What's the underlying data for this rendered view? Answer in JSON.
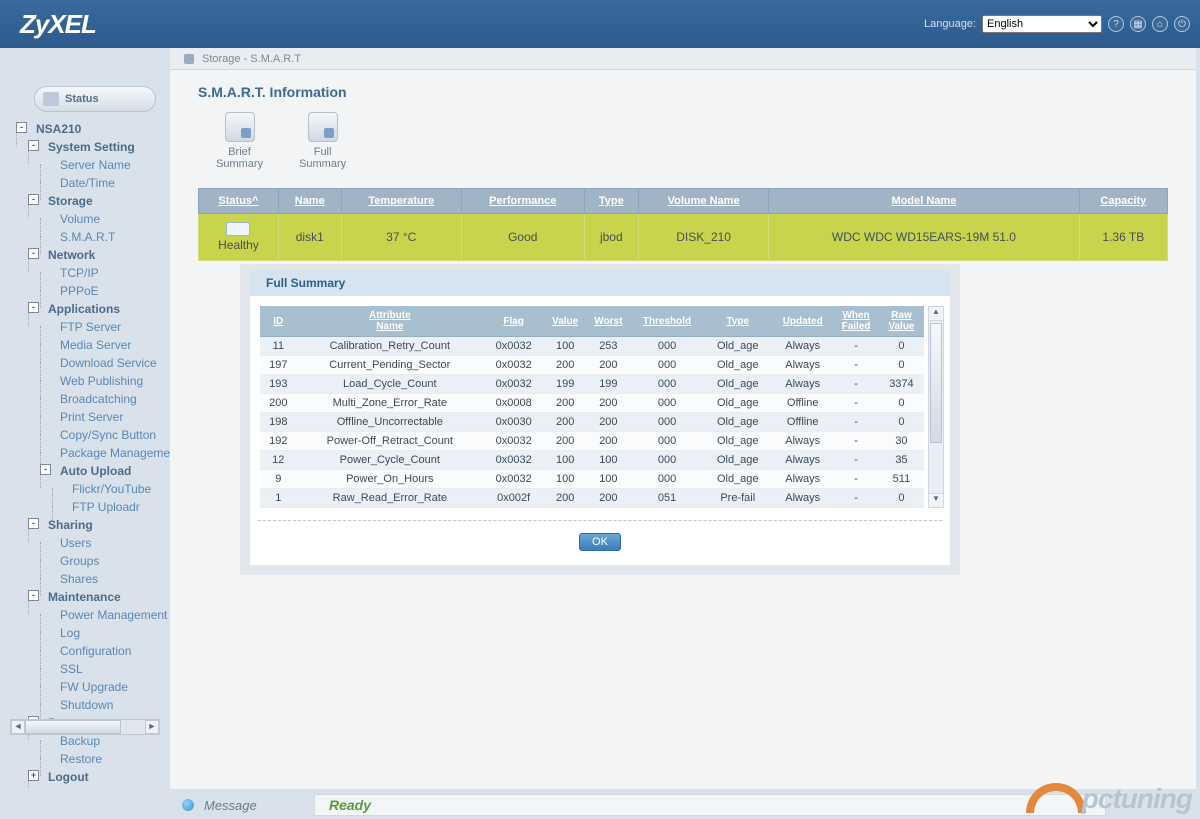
{
  "brand": "ZyXEL",
  "topbar": {
    "language_label": "Language:",
    "language_value": "English"
  },
  "breadcrumb": "Storage - S.M.A.R.T",
  "sidebar": {
    "status": "Status",
    "root": "NSA210",
    "nodes": [
      {
        "label": "System Setting",
        "children": [
          "Server Name",
          "Date/Time"
        ]
      },
      {
        "label": "Storage",
        "children": [
          "Volume",
          "S.M.A.R.T"
        ]
      },
      {
        "label": "Network",
        "children": [
          "TCP/IP",
          "PPPoE"
        ]
      },
      {
        "label": "Applications",
        "children": [
          "FTP Server",
          "Media Server",
          "Download Service",
          "Web Publishing",
          "Broadcatching",
          "Print Server",
          "Copy/Sync Button",
          "Package Manageme"
        ]
      },
      {
        "label": "Auto Upload",
        "children": [
          "Flickr/YouTube",
          "FTP Uploadr"
        ],
        "indent": true
      },
      {
        "label": "Sharing",
        "children": [
          "Users",
          "Groups",
          "Shares"
        ]
      },
      {
        "label": "Maintenance",
        "children": [
          "Power Management",
          "Log",
          "Configuration",
          "SSL",
          "FW Upgrade",
          "Shutdown"
        ]
      },
      {
        "label": "Protect",
        "children": [
          "Backup",
          "Restore"
        ]
      },
      {
        "label": "Logout",
        "children": []
      }
    ]
  },
  "page": {
    "title": "S.M.A.R.T. Information",
    "actions": {
      "brief": "Brief\nSummary",
      "full": "Full\nSummary"
    },
    "disk_table": {
      "headers": [
        "Status",
        "Name",
        "Temperature",
        "Performance",
        "Type",
        "Volume Name",
        "Model Name",
        "Capacity"
      ],
      "row": {
        "status": "Healthy",
        "name": "disk1",
        "temp": "37 °C",
        "perf": "Good",
        "type": "jbod",
        "vol": "DISK_210",
        "model": "WDC WDC WD15EARS-19M 51.0",
        "cap": "1.36 TB"
      }
    }
  },
  "modal": {
    "title": "Full Summary",
    "headers": [
      "ID",
      "Attribute Name",
      "Flag",
      "Value",
      "Worst",
      "Threshold",
      "Type",
      "Updated",
      "When Failed",
      "Raw Value"
    ],
    "rows": [
      {
        "id": "11",
        "attr": "Calibration_Retry_Count",
        "flag": "0x0032",
        "val": "100",
        "worst": "253",
        "thr": "000",
        "type": "Old_age",
        "upd": "Always",
        "fail": "-",
        "raw": "0"
      },
      {
        "id": "197",
        "attr": "Current_Pending_Sector",
        "flag": "0x0032",
        "val": "200",
        "worst": "200",
        "thr": "000",
        "type": "Old_age",
        "upd": "Always",
        "fail": "-",
        "raw": "0"
      },
      {
        "id": "193",
        "attr": "Load_Cycle_Count",
        "flag": "0x0032",
        "val": "199",
        "worst": "199",
        "thr": "000",
        "type": "Old_age",
        "upd": "Always",
        "fail": "-",
        "raw": "3374"
      },
      {
        "id": "200",
        "attr": "Multi_Zone_Error_Rate",
        "flag": "0x0008",
        "val": "200",
        "worst": "200",
        "thr": "000",
        "type": "Old_age",
        "upd": "Offline",
        "fail": "-",
        "raw": "0"
      },
      {
        "id": "198",
        "attr": "Offline_Uncorrectable",
        "flag": "0x0030",
        "val": "200",
        "worst": "200",
        "thr": "000",
        "type": "Old_age",
        "upd": "Offline",
        "fail": "-",
        "raw": "0"
      },
      {
        "id": "192",
        "attr": "Power-Off_Retract_Count",
        "flag": "0x0032",
        "val": "200",
        "worst": "200",
        "thr": "000",
        "type": "Old_age",
        "upd": "Always",
        "fail": "-",
        "raw": "30"
      },
      {
        "id": "12",
        "attr": "Power_Cycle_Count",
        "flag": "0x0032",
        "val": "100",
        "worst": "100",
        "thr": "000",
        "type": "Old_age",
        "upd": "Always",
        "fail": "-",
        "raw": "35"
      },
      {
        "id": "9",
        "attr": "Power_On_Hours",
        "flag": "0x0032",
        "val": "100",
        "worst": "100",
        "thr": "000",
        "type": "Old_age",
        "upd": "Always",
        "fail": "-",
        "raw": "511"
      },
      {
        "id": "1",
        "attr": "Raw_Read_Error_Rate",
        "flag": "0x002f",
        "val": "200",
        "worst": "200",
        "thr": "051",
        "type": "Pre-fail",
        "upd": "Always",
        "fail": "-",
        "raw": "0"
      }
    ],
    "ok": "OK"
  },
  "statusbar": {
    "message": "Message",
    "ready": "Ready"
  },
  "watermark": "pctuning"
}
